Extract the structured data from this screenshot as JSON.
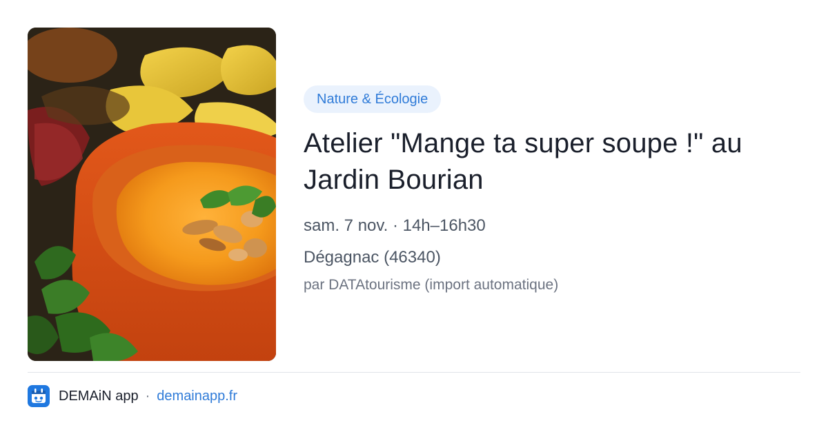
{
  "event": {
    "image_alt": "pumpkin-soup-photo",
    "category": "Nature & Écologie",
    "title": "Atelier \"Mange ta super soupe !\" au Jardin Bourian",
    "datetime": "sam. 7 nov. · 14h–16h30",
    "location": "Dégagnac (46340)",
    "source": "par DATAtourisme (import automatique)"
  },
  "footer": {
    "app_icon": "demain-app-icon",
    "app_name": "DEMAiN app",
    "separator": "·",
    "domain": "demainapp.fr"
  },
  "colors": {
    "accent": "#2f7bd8",
    "badge_bg": "#eaf2fd",
    "title": "#1a1f2b",
    "meta": "#4b5563",
    "divider": "#dfe3e8"
  }
}
